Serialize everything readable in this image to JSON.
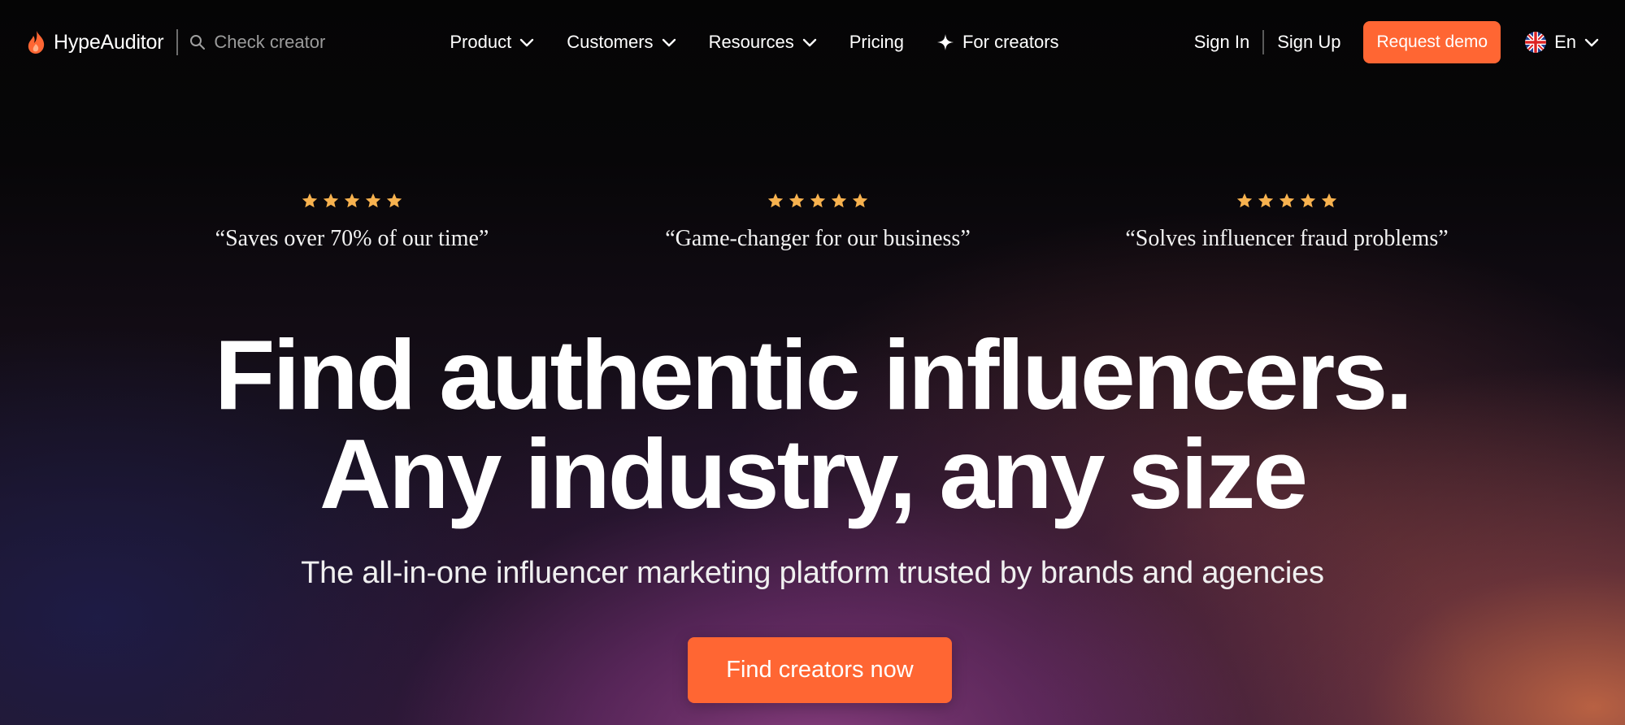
{
  "nav": {
    "brand": "HypeAuditor",
    "search_placeholder": "Check creator",
    "menu": [
      {
        "label": "Product"
      },
      {
        "label": "Customers"
      },
      {
        "label": "Resources"
      },
      {
        "label": "Pricing"
      },
      {
        "label": "For creators"
      }
    ],
    "sign_in": "Sign In",
    "sign_up": "Sign Up",
    "request_demo": "Request demo",
    "language": "En"
  },
  "testimonials": [
    {
      "rating": 5,
      "text": "“Saves over 70% of our time”"
    },
    {
      "rating": 5,
      "text": "“Game-changer for our business”"
    },
    {
      "rating": 5,
      "text": "“Solves influencer fraud problems”"
    }
  ],
  "hero": {
    "title_line1": "Find authentic influencers.",
    "title_line2": "Any industry, any size",
    "subtitle": "The all-in-one influencer marketing platform trusted by brands and agencies",
    "cta": "Find creators now"
  },
  "colors": {
    "accent": "#ff6633",
    "star": "#f7b24f",
    "background": "#050505"
  },
  "icons": {
    "logo": "flame-icon",
    "search": "search-icon",
    "dropdown": "chevron-down-icon",
    "for_creators": "sparkle-icon",
    "language": "uk-flag-icon",
    "rating": "star-icon"
  }
}
